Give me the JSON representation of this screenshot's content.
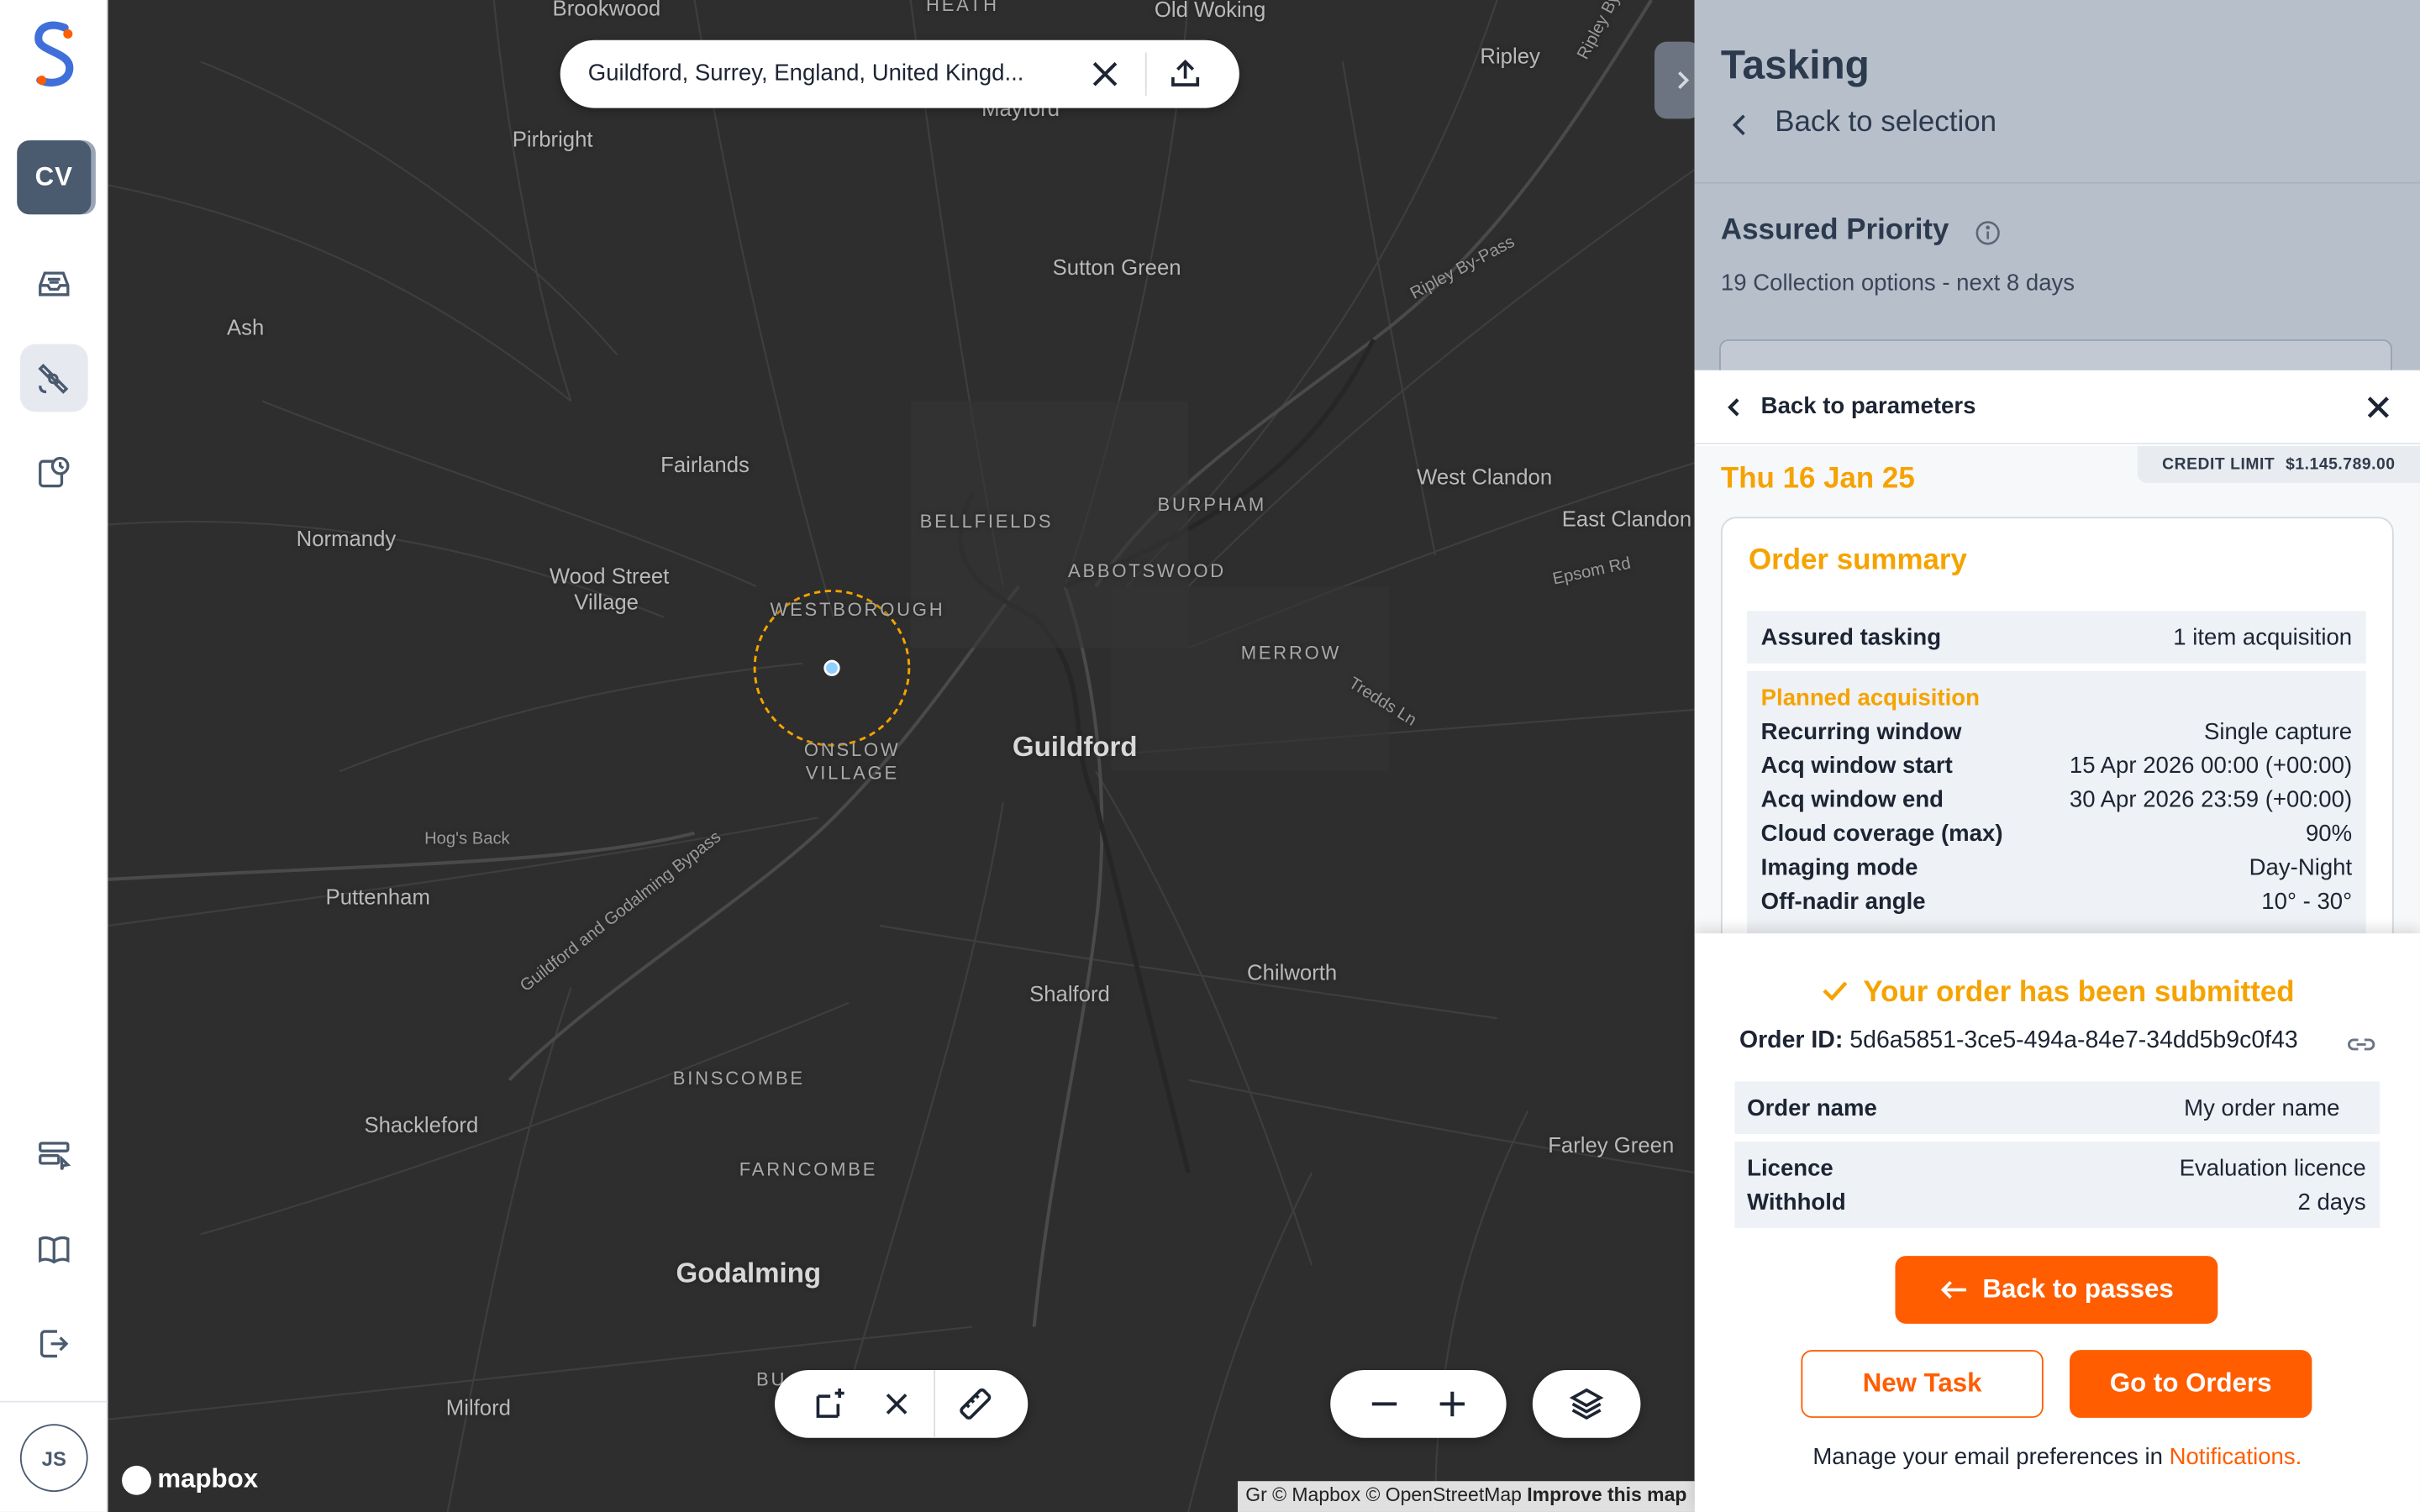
{
  "app": {
    "logo_alt": "S",
    "workspace_initials": "CV",
    "user_initials": "JS"
  },
  "icons": {
    "rail": [
      "inbox-icon",
      "satellite-icon",
      "history-icon",
      "tasks-icon",
      "book-icon",
      "logout-icon"
    ],
    "search": [
      "close-icon",
      "upload-icon"
    ],
    "map_tools": [
      "draw-shape-icon",
      "clear-icon",
      "ruler-icon",
      "zoom-out-icon",
      "zoom-in-icon",
      "layers-icon"
    ]
  },
  "colors": {
    "accent": "#ff5d00",
    "highlight": "#f5a300",
    "rail_active": "#4a5a6f",
    "panel_header": "#b7bfcb"
  },
  "map": {
    "search_value": "Guildford, Surrey, England, United Kingd...",
    "places": [
      {
        "name": "Brookwood",
        "cls": ""
      },
      {
        "name": "HEATH",
        "cls": "small"
      },
      {
        "name": "Old Woking",
        "cls": ""
      },
      {
        "name": "Ripley",
        "cls": ""
      },
      {
        "name": "Mayford",
        "cls": ""
      },
      {
        "name": "Pirbright",
        "cls": ""
      },
      {
        "name": "Ash",
        "cls": ""
      },
      {
        "name": "Sutton Green",
        "cls": ""
      },
      {
        "name": "Fairlands",
        "cls": ""
      },
      {
        "name": "Normandy",
        "cls": ""
      },
      {
        "name": "BELLFIELDS",
        "cls": "small"
      },
      {
        "name": "BURPHAM",
        "cls": "small"
      },
      {
        "name": "West Clandon",
        "cls": ""
      },
      {
        "name": "East Clandon",
        "cls": ""
      },
      {
        "name": "Wood Street",
        "cls": ""
      },
      {
        "name": "Village",
        "cls": ""
      },
      {
        "name": "WESTBOROUGH",
        "cls": "small"
      },
      {
        "name": "ABBOTSWOOD",
        "cls": "small"
      },
      {
        "name": "MERROW",
        "cls": "small"
      },
      {
        "name": "ONSLOW",
        "cls": "small"
      },
      {
        "name": "VILLAGE",
        "cls": "small"
      },
      {
        "name": "Guildford",
        "cls": "big"
      },
      {
        "name": "Hog's Back",
        "cls": "road"
      },
      {
        "name": "Puttenham",
        "cls": ""
      },
      {
        "name": "Shalford",
        "cls": ""
      },
      {
        "name": "Chilworth",
        "cls": ""
      },
      {
        "name": "BINSCOMBE",
        "cls": "small"
      },
      {
        "name": "Shackleford",
        "cls": ""
      },
      {
        "name": "FARNCOMBE",
        "cls": "small"
      },
      {
        "name": "Farley Green",
        "cls": ""
      },
      {
        "name": "Godalming",
        "cls": "big"
      },
      {
        "name": "Milford",
        "cls": ""
      },
      {
        "name": "BU",
        "cls": "small"
      }
    ],
    "roads": [
      {
        "name": "Ripley By-Pass"
      },
      {
        "name": "Ripley By-Pass"
      },
      {
        "name": "Epsom Rd"
      },
      {
        "name": "Tredds Ln"
      },
      {
        "name": "Guildford and Godalming Bypass"
      }
    ],
    "mapbox_label": "mapbox",
    "attribution": {
      "part1": "Gr",
      "part2": "© Mapbox © OpenStreetMap",
      "improve": "Improve this map"
    }
  },
  "panel": {
    "title": "Tasking",
    "back_to_selection": "Back to selection",
    "priority_title": "Assured Priority",
    "collection_options": "19 Collection options - next 8 days",
    "date_peek": "16 Jan 2025",
    "back_to_parameters": "Back to parameters",
    "credit_label": "CREDIT LIMIT",
    "credit_value": "$1.145.789.00",
    "date_heading": "Thu 16 Jan 25",
    "summary": {
      "title": "Order summary",
      "tasking_label": "Assured tasking",
      "tasking_value": "1 item acquisition",
      "planned_title": "Planned acquisition",
      "rows": [
        {
          "k": "Recurring window",
          "v": "Single capture"
        },
        {
          "k": "Acq window start",
          "v": "15 Apr 2026 00:00 (+00:00)"
        },
        {
          "k": "Acq window end",
          "v": "30 Apr 2026 23:59 (+00:00)"
        },
        {
          "k": "Cloud coverage (max)",
          "v": "90%"
        },
        {
          "k": "Imaging mode",
          "v": "Day-Night"
        },
        {
          "k": "Off-nadir angle",
          "v": "10° - 30°"
        }
      ]
    },
    "confirmation": {
      "message": "Your order has been submitted",
      "order_id_label": "Order ID:",
      "order_id": "5d6a5851-3ce5-494a-84e7-34dd5b9c0f43",
      "order_name_label": "Order name",
      "order_name_value": "My order name",
      "licence_label": "Licence",
      "licence_value": "Evaluation licence",
      "withhold_label": "Withhold",
      "withhold_value": "2 days",
      "back_to_passes": "Back to passes",
      "new_task": "New Task",
      "go_to_orders": "Go to Orders",
      "email_pref_text": "Manage your email preferences in",
      "email_pref_link": "Notifications."
    }
  }
}
